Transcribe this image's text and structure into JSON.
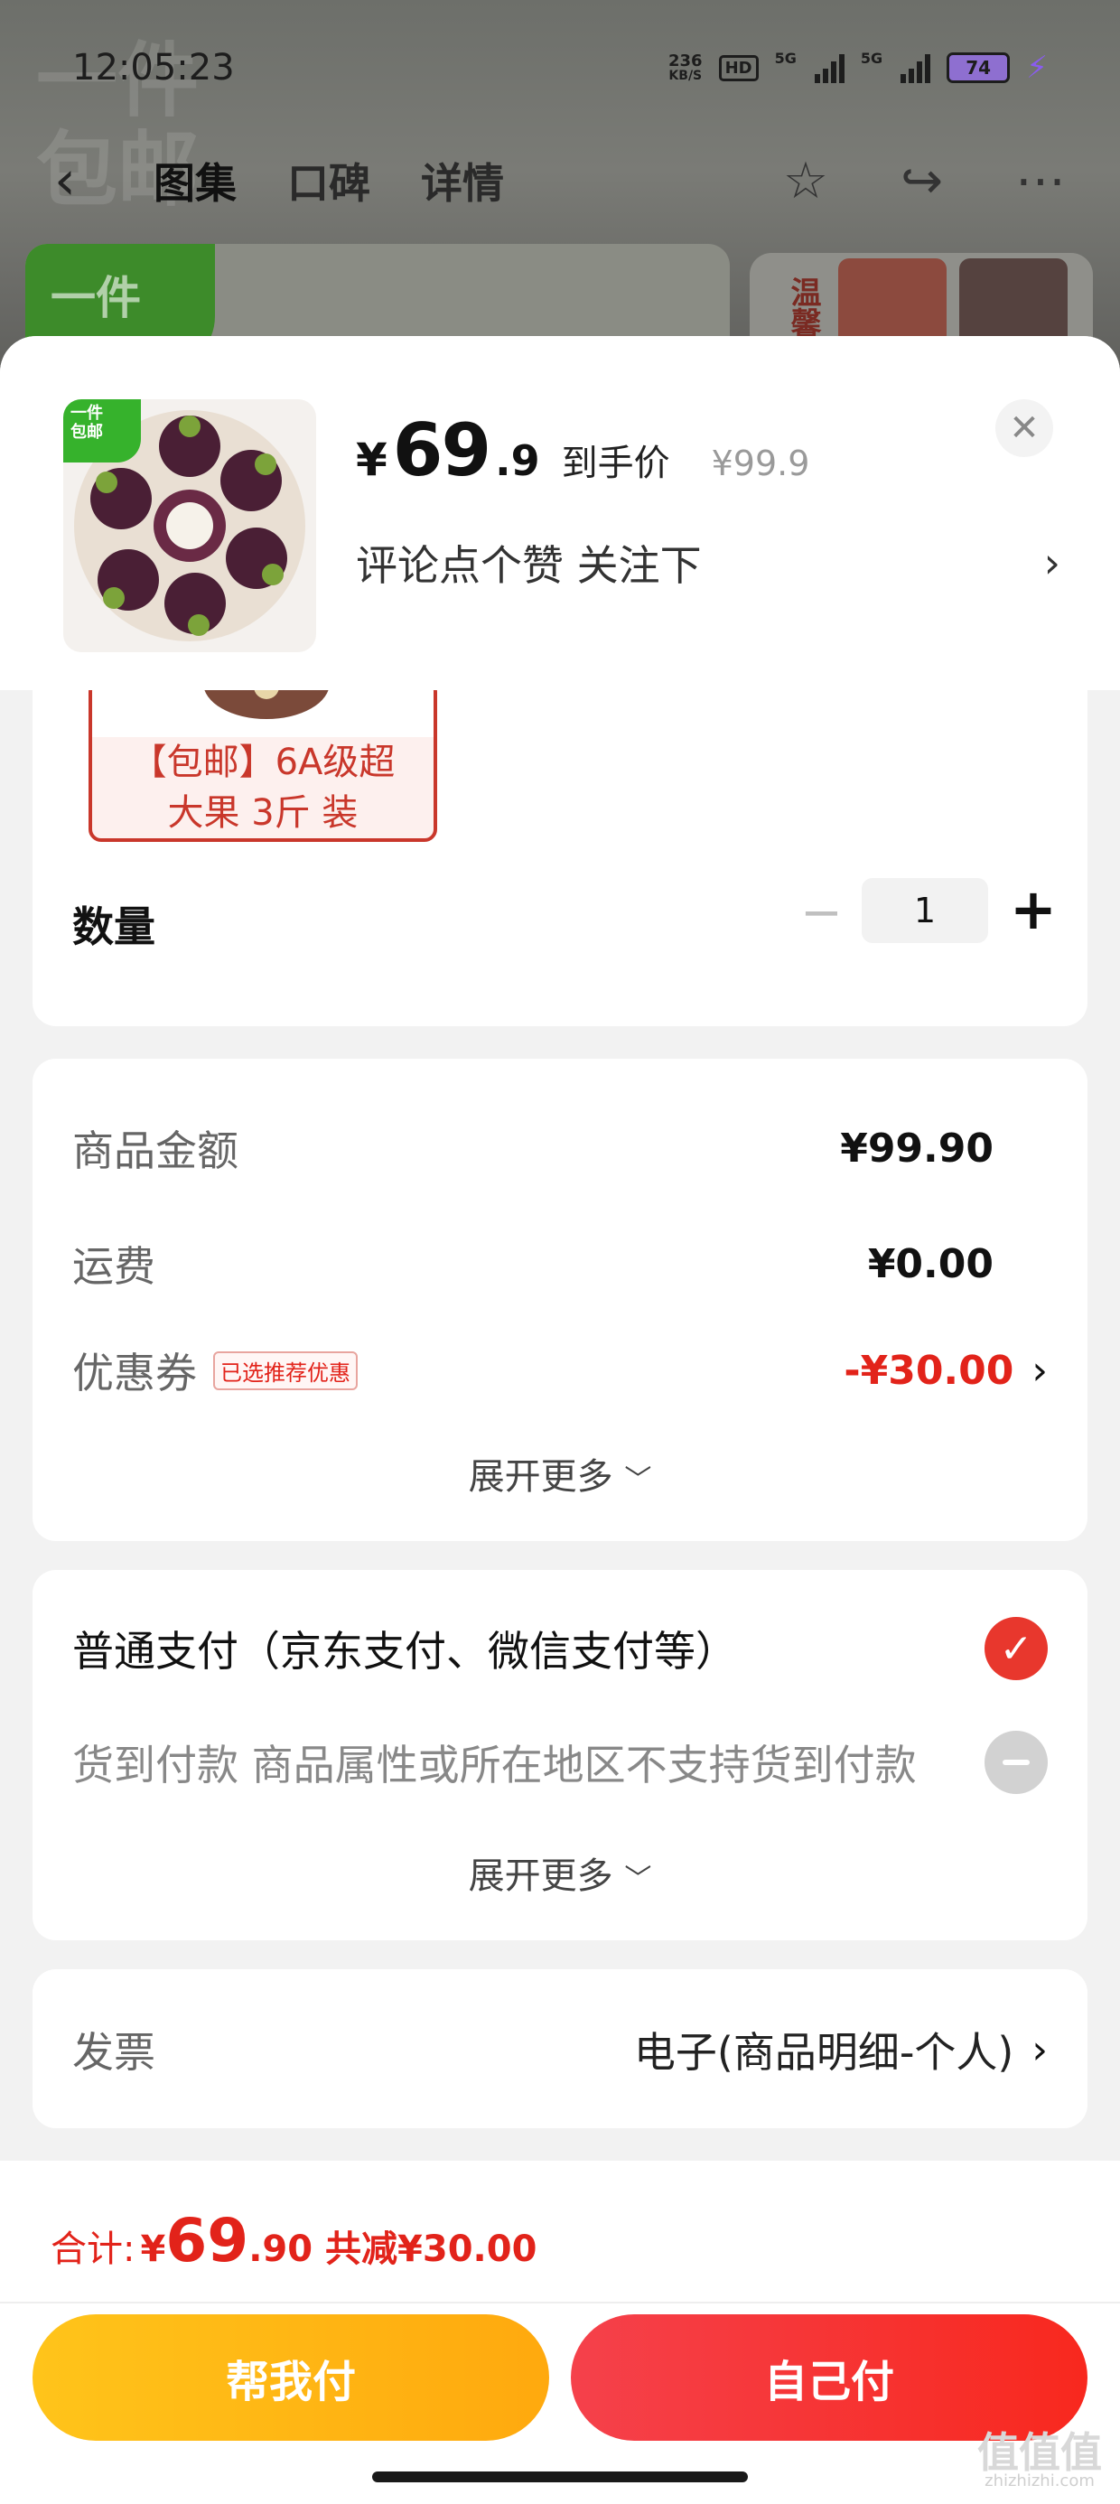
{
  "status_bar": {
    "time": "12:05:23",
    "net_speed_value": "236",
    "net_speed_unit": "KB/S",
    "hd_badge": "HD",
    "sig1_label": "5G",
    "sig2_label": "5G",
    "battery": "74"
  },
  "nav": {
    "back_icon": "back-arrow-icon",
    "tabs": [
      "图集",
      "口碑",
      "详情"
    ],
    "actions": [
      "star-icon",
      "share-icon",
      "more-icon"
    ]
  },
  "background": {
    "banner_tag": "一件\n包邮",
    "side_text": "温馨"
  },
  "sheet": {
    "thumb_tag": "一件\n包邮",
    "price_symbol": "¥",
    "price_int": "69",
    "price_dec": ".9",
    "price_note": "到手价",
    "price_orig": "¥99.9",
    "spec_text": "评论点个赞  关注下",
    "close_icon": "close-icon"
  },
  "spec": {
    "option_label_line1": "【包邮】6A级超",
    "option_label_line2": "大果 3斤  装",
    "qty_label": "数量",
    "qty_minus": "−",
    "qty_value": "1",
    "qty_plus": "+"
  },
  "cost": {
    "goods_label": "商品金额",
    "goods_value": "¥99.90",
    "shipping_label": "运费",
    "shipping_value": "¥0.00",
    "coupon_label": "优惠券",
    "coupon_badge": "已选推荐优惠",
    "coupon_value": "-¥30.00",
    "expand": "展开更多"
  },
  "payment": {
    "option1": "普通支付（京东支付、微信支付等）",
    "option2": "货到付款  商品属性或所在地区不支持货到付款",
    "expand": "展开更多"
  },
  "invoice": {
    "label": "发票",
    "value": "电子(商品明细-个人)"
  },
  "bottom": {
    "total_label": "合计:",
    "total_sym": "¥",
    "total_int": "69",
    "total_dec": ".90",
    "total_save": "共减¥30.00",
    "btn_help": "帮我付",
    "btn_self": "自己付"
  },
  "watermark": {
    "text": "值值值",
    "sub": "zhizhizhi.com"
  },
  "colors": {
    "accent_red": "#e2231a",
    "help_yellow": "#ffb514",
    "green_tag": "#36b22c"
  }
}
